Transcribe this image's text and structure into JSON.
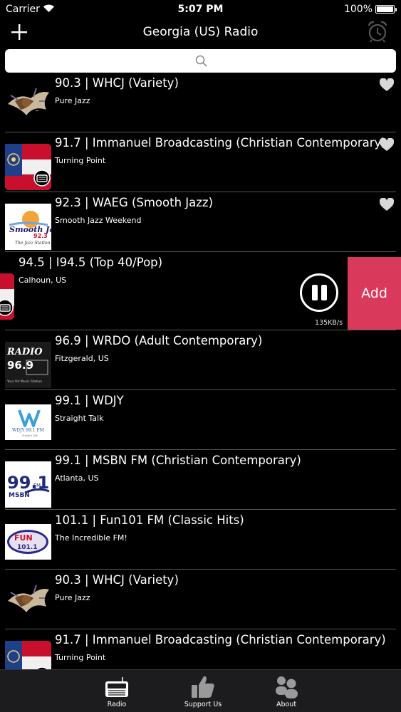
{
  "status_bar": {
    "carrier": "Carrier",
    "time": "5:07 PM",
    "battery": "100%"
  },
  "nav": {
    "title": "Georgia (US) Radio",
    "add_icon": "plus-icon",
    "alarm_icon": "alarm-clock-icon"
  },
  "search": {
    "placeholder": "",
    "value": "",
    "icon": "search-icon"
  },
  "stations": [
    {
      "name": "90.3 | WHCJ (Variety)",
      "subtitle": "Pure Jazz",
      "logo": "whcj-logo",
      "favorite_icon": "heart-icon"
    },
    {
      "name": "91.7 | Immanuel Broadcasting (Christian Contemporary)",
      "subtitle": "Turning Point",
      "logo": "georgia-flag-logo",
      "favorite_icon": "heart-icon"
    },
    {
      "name": "92.3 | WAEG (Smooth Jazz)",
      "subtitle": "Smooth Jazz Weekend",
      "logo": "smooth-jazz-logo",
      "favorite_icon": "heart-icon"
    },
    {
      "name": "94.5 | I94.5 (Top 40/Pop)",
      "subtitle": "Calhoun, US",
      "logo": "georgia-flag-logo",
      "playing": true,
      "speed": "135KB/s",
      "add_label": "Add"
    },
    {
      "name": "96.9 | WRDO (Adult Contemporary)",
      "subtitle": "Fitzgerald, US",
      "logo": "radio-96-9-logo"
    },
    {
      "name": "99.1 | WDJY",
      "subtitle": "Straight Talk",
      "logo": "wdjy-logo"
    },
    {
      "name": "99.1 | MSBN FM (Christian Contemporary)",
      "subtitle": "Atlanta, US",
      "logo": "msbn-logo"
    },
    {
      "name": "101.1 | Fun101 FM (Classic Hits)",
      "subtitle": "The Incredible FM!",
      "logo": "fun101-logo"
    },
    {
      "name": "90.3 | WHCJ (Variety)",
      "subtitle": "Pure Jazz",
      "logo": "whcj-logo"
    },
    {
      "name": "91.7 | Immanuel Broadcasting (Christian Contemporary)",
      "subtitle": "Turning Point",
      "logo": "georgia-flag-logo"
    }
  ],
  "logo_texts": {
    "smooth_jazz": "Smooth Jazz",
    "smooth_jazz_freq": "92.3",
    "smooth_jazz_tag": "The Jazz Station",
    "radio969_word": "RADIO",
    "radio969_freq": "96.9",
    "radio969_tag": "Your Hit Music Station",
    "wdjy_call": "WDJY 99.1 FM",
    "wdjy_tag": "Straight Talk",
    "msbn_freq": "99.1",
    "msbn_fm": "FM",
    "msbn_call": "MSBN",
    "fun_word": "FUN",
    "fun_freq": "101.1"
  },
  "tabs": [
    {
      "label": "Radio",
      "icon": "radio-icon"
    },
    {
      "label": "Support Us",
      "icon": "thumbs-up-icon"
    },
    {
      "label": "About",
      "icon": "people-icon"
    }
  ],
  "colors": {
    "accent_add": "#d9395b",
    "background": "#000000",
    "separator": "#555555"
  }
}
